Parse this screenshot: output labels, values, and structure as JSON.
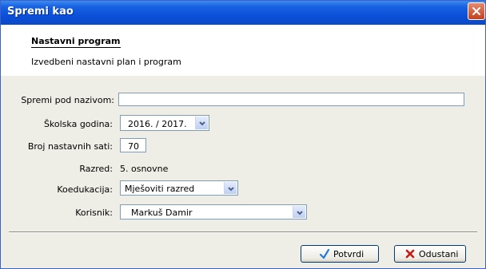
{
  "window": {
    "title": "Spremi kao",
    "title_bar_color": "#0b4fd8",
    "close_icon": "close-icon"
  },
  "header": {
    "section_title": "Nastavni program",
    "section_subtitle": "Izvedbeni nastavni plan i program"
  },
  "form": {
    "name_label": "Spremi pod nazivom:",
    "name_value": "",
    "school_year_label": "Školska godina:",
    "school_year_value": "2016. / 2017.",
    "hours_label": "Broj nastavnih sati:",
    "hours_value": "70",
    "grade_label": "Razred:",
    "grade_value": "5. osnovne",
    "coed_label": "Koedukacija:",
    "coed_value": "Mješoviti razred",
    "user_label": "Korisnik:",
    "user_value": "Markuš Damir"
  },
  "buttons": {
    "confirm_label": "Potvrdi",
    "confirm_icon": "checkmark-icon",
    "cancel_label": "Odustani",
    "cancel_icon": "x-icon"
  }
}
